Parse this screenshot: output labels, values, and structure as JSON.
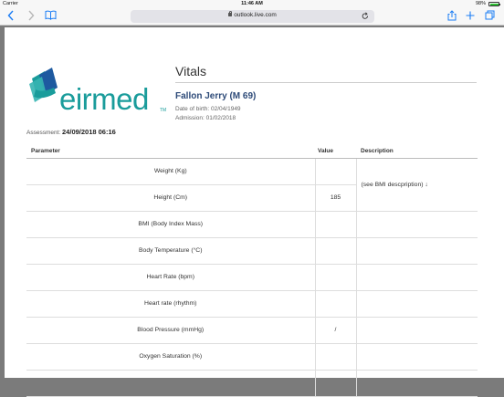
{
  "status_bar": {
    "carrier": "Carrier",
    "time": "11:46 AM",
    "battery": "98%"
  },
  "browser": {
    "back_icon": "chevron-left-icon",
    "forward_icon": "chevron-right-icon",
    "url": "outlook.live.com"
  },
  "page": {
    "logo_text": "eirmed",
    "logo_tm": "TM",
    "title": "Vitals",
    "patient_name": "Fallon Jerry (M 69)",
    "dob": "Date of birth: 02/04/1949",
    "admission": "Admission: 01/02/2018",
    "assessment_label": "Assessment: ",
    "assessment_value": "24/09/2018 06:16",
    "table": {
      "headers": [
        "Parameter",
        "Value",
        "Description"
      ],
      "rows": [
        {
          "parameter": "Weight (Kg)",
          "value": "",
          "description": ""
        },
        {
          "parameter": "Height (Cm)",
          "value": "185",
          "description": "(see BMI descpription) ↓"
        },
        {
          "parameter": "BMI (Body Index Mass)",
          "value": "",
          "description": ""
        },
        {
          "parameter": "Body Temperature (°C)",
          "value": "",
          "description": ""
        },
        {
          "parameter": "Heart Rate (bpm)",
          "value": "",
          "description": ""
        },
        {
          "parameter": "Heart rate (rhythm)",
          "value": "",
          "description": ""
        },
        {
          "parameter": "Blood Pressure (mmHg)",
          "value": "/",
          "description": ""
        },
        {
          "parameter": "Oxygen Saturation (%)",
          "value": "",
          "description": ""
        },
        {
          "parameter": "",
          "value": "",
          "description": ""
        }
      ]
    }
  },
  "colors": {
    "brand": "#1a9c9b",
    "accent": "#1a7cf5",
    "patient": "#2d4a78"
  }
}
